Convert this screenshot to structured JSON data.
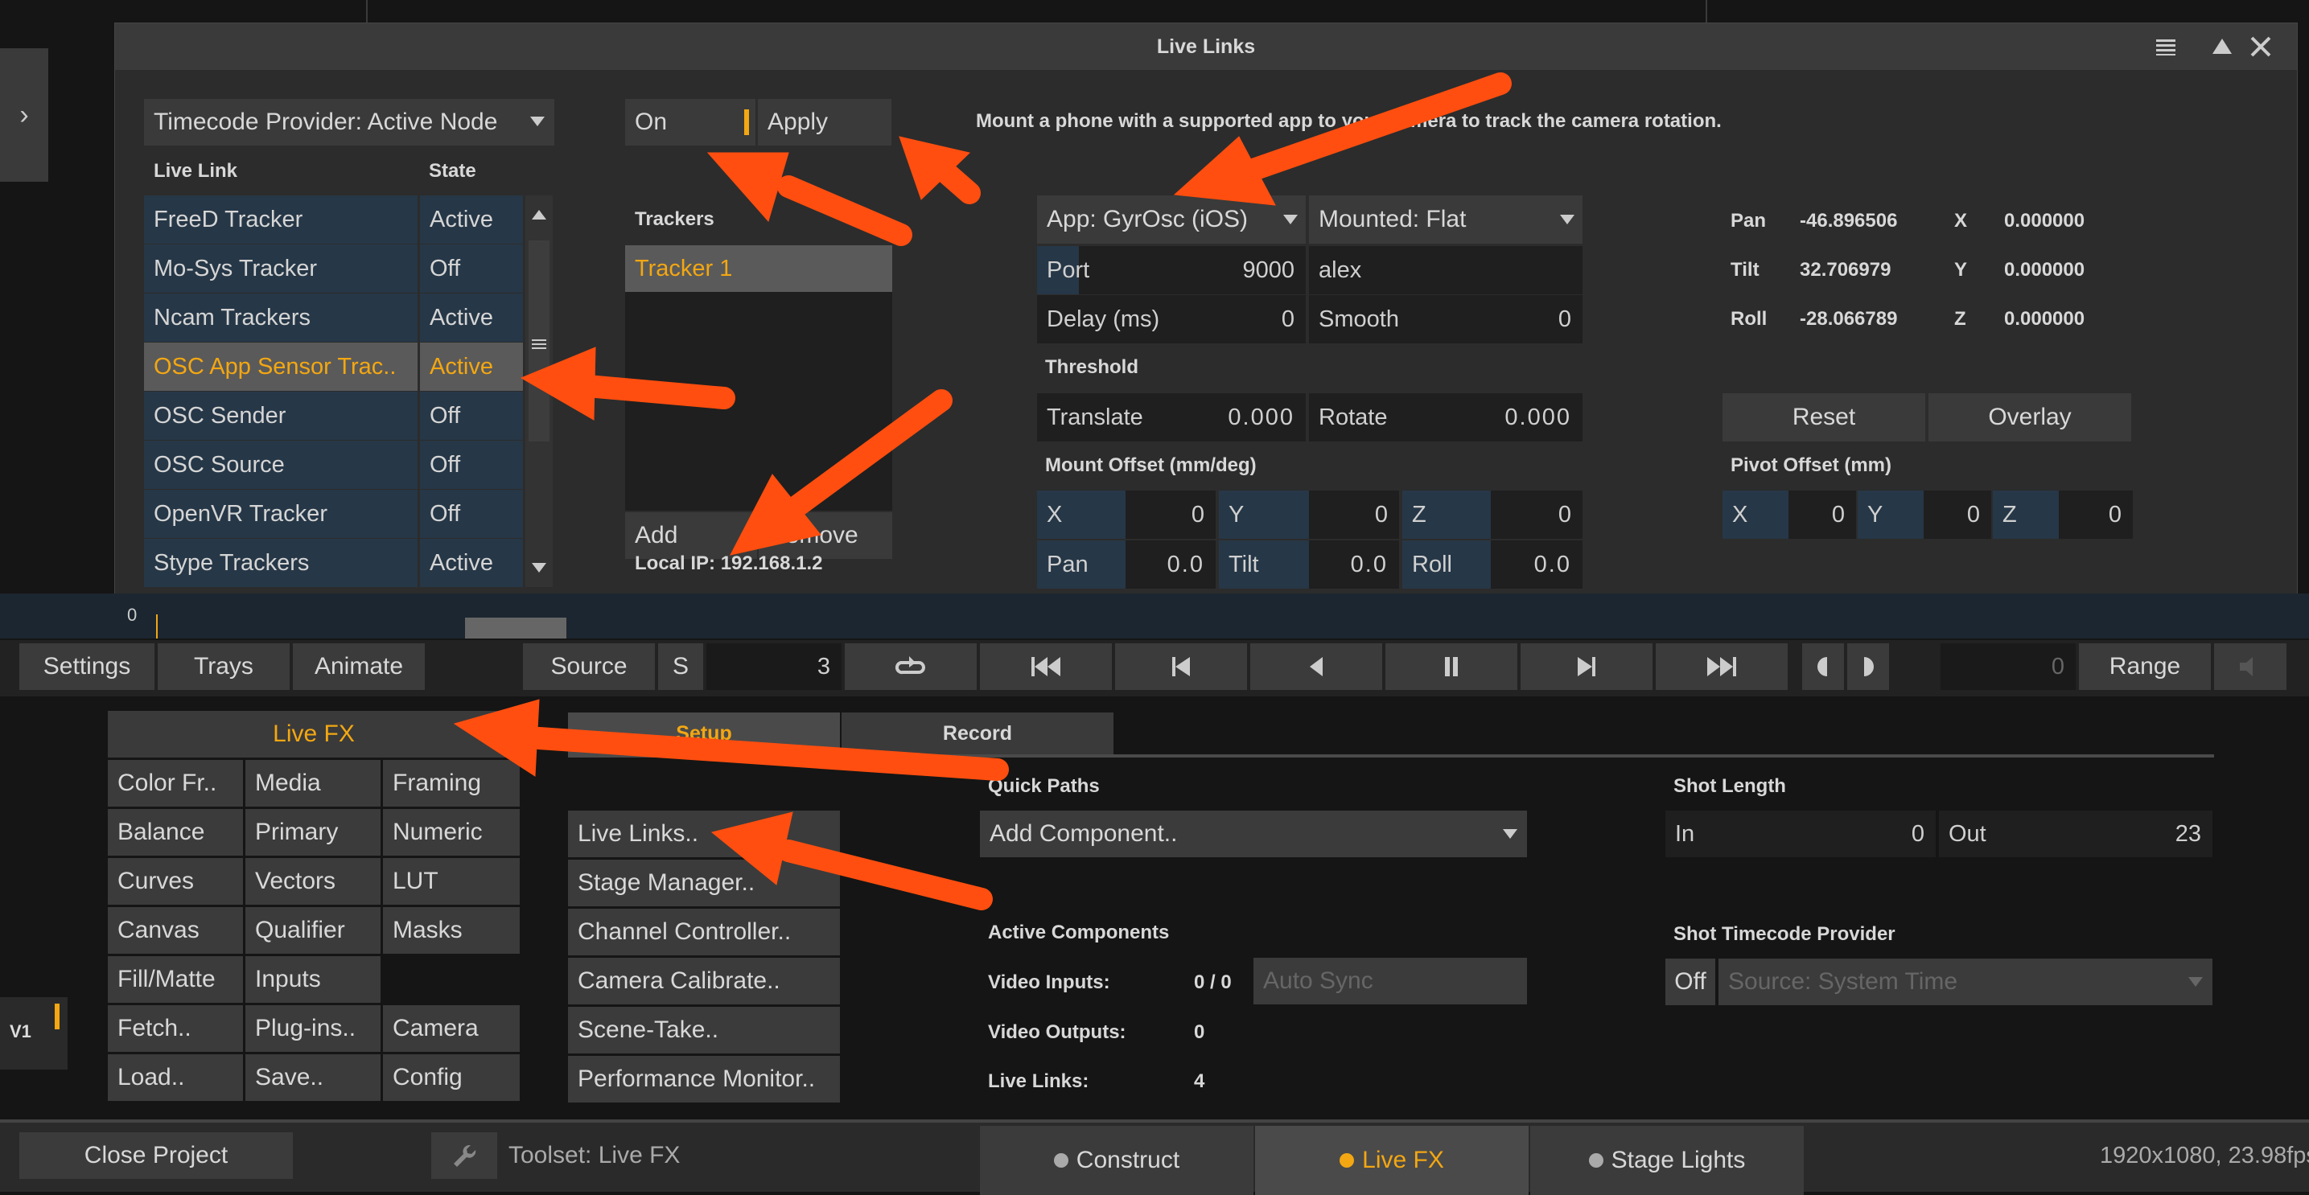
{
  "window": {
    "title": "Live Links",
    "timecode_provider": "Timecode Provider: Active Node",
    "table": {
      "headers": [
        "Live Link",
        "State"
      ],
      "rows": [
        {
          "name": "FreeD Tracker",
          "state": "Active"
        },
        {
          "name": "Mo-Sys Tracker",
          "state": "Off"
        },
        {
          "name": "Ncam Trackers",
          "state": "Active"
        },
        {
          "name": "OSC App Sensor Trac..",
          "state": "Active"
        },
        {
          "name": "OSC Sender",
          "state": "Off"
        },
        {
          "name": "OSC Source",
          "state": "Off"
        },
        {
          "name": "OpenVR Tracker",
          "state": "Off"
        },
        {
          "name": "Stype Trackers",
          "state": "Active"
        }
      ]
    },
    "on_label": "On",
    "apply_label": "Apply",
    "trackers_title": "Trackers",
    "tracker_1": "Tracker 1",
    "add_label": "Add",
    "remove_label": "Remove",
    "local_ip": "Local IP: 192.168.1.2",
    "description": "Mount a phone with a supported app to your camera to track the camera rotation.",
    "app_select": "App: GyrOsc (iOS)",
    "mounted_select": "Mounted: Flat",
    "port_label": "Port",
    "port_value": "9000",
    "host_value": "alex",
    "delay_label": "Delay (ms)",
    "delay_value": "0",
    "smooth_label": "Smooth",
    "smooth_value": "0",
    "threshold_title": "Threshold",
    "translate_label": "Translate",
    "translate_value": "0.000",
    "rotate_label": "Rotate",
    "rotate_value": "0.000",
    "mount_offset_title": "Mount Offset (mm/deg)",
    "mount": {
      "x_label": "X",
      "x": "0",
      "y_label": "Y",
      "y": "0",
      "z_label": "Z",
      "z": "0",
      "pan_label": "Pan",
      "pan": "0.0",
      "tilt_label": "Tilt",
      "tilt": "0.0",
      "roll_label": "Roll",
      "roll": "0.0"
    },
    "readout": {
      "pan_label": "Pan",
      "pan": "-46.896506",
      "x_label": "X",
      "x": "0.000000",
      "tilt_label": "Tilt",
      "tilt": "32.706979",
      "y_label": "Y",
      "y": "0.000000",
      "roll_label": "Roll",
      "roll": "-28.066789",
      "z_label": "Z",
      "z": "0.000000"
    },
    "reset_label": "Reset",
    "overlay_label": "Overlay",
    "pivot_offset_title": "Pivot Offset (mm)",
    "pivot": {
      "x_label": "X",
      "x": "0",
      "y_label": "Y",
      "y": "0",
      "z_label": "Z",
      "z": "0"
    }
  },
  "timeline": {
    "frame": "0"
  },
  "transport": {
    "settings": "Settings",
    "trays": "Trays",
    "animate": "Animate",
    "source": "Source",
    "s": "S",
    "frame": "3",
    "end_frame": "0",
    "range": "Range"
  },
  "menu": {
    "title": "Live FX",
    "col1": [
      "Color Fr..",
      "Balance",
      "Curves",
      "Canvas",
      "Fill/Matte",
      "Fetch..",
      "Load.."
    ],
    "col2": [
      "Media",
      "Primary",
      "Vectors",
      "Qualifier",
      "Inputs",
      "Plug-ins..",
      "Save.."
    ],
    "col3": [
      "Framing",
      "Numeric",
      "LUT",
      "Masks",
      "",
      "Camera",
      "Config"
    ]
  },
  "tabs": {
    "setup": "Setup",
    "record": "Record"
  },
  "setup_list": [
    "Live Links..",
    "Stage Manager..",
    "Channel Controller..",
    "Camera Calibrate..",
    "Scene-Take..",
    "Performance Monitor.."
  ],
  "quick_paths": {
    "title": "Quick Paths",
    "add_component": "Add Component.."
  },
  "active_components": {
    "title": "Active Components",
    "video_inputs_label": "Video Inputs:",
    "video_inputs": "0 / 0",
    "auto_sync": "Auto Sync",
    "video_outputs_label": "Video Outputs:",
    "video_outputs": "0",
    "live_links_label": "Live Links:",
    "live_links": "4"
  },
  "shot_length": {
    "title": "Shot Length",
    "in_label": "In",
    "in": "0",
    "out_label": "Out",
    "out": "23"
  },
  "shot_tc": {
    "title": "Shot Timecode Provider",
    "off": "Off",
    "source": "Source: System Time"
  },
  "layer": "V1",
  "bottom": {
    "close_project": "Close Project",
    "toolset": "Toolset: Live FX",
    "construct": "Construct",
    "live_fx": "Live FX",
    "stage_lights": "Stage Lights",
    "resolution": "1920x1080, 23.98fps"
  },
  "colors": {
    "accent": "#f3a712",
    "annotation_arrow": "#ff4e0f",
    "cell_blue": "#263747"
  }
}
